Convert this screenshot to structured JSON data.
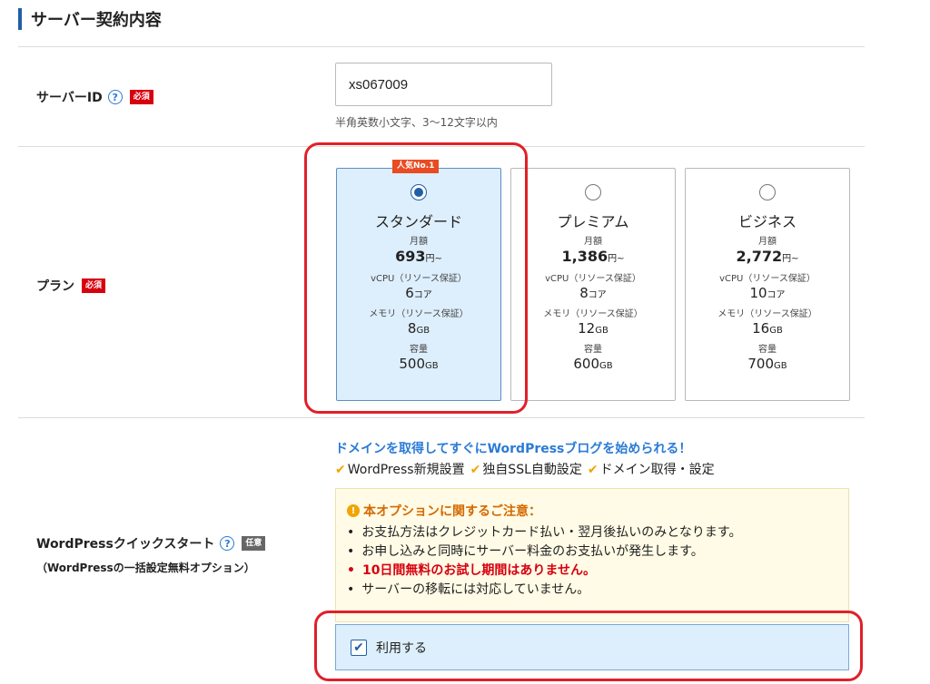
{
  "section": {
    "title": "サーバー契約内容"
  },
  "server_id": {
    "label": "サーバーID",
    "help": "?",
    "required": "必須",
    "value": "xs067009",
    "hint": "半角英数小文字、3〜12文字以内"
  },
  "plan": {
    "label": "プラン",
    "required": "必須",
    "popular_badge": "人気No.1",
    "items": [
      {
        "name": "スタンダード",
        "monthly_label": "月額",
        "price": "693",
        "price_unit": "円~",
        "vcpu_label": "vCPU（リソース保証）",
        "vcpu": "6",
        "vcpu_unit": "コア",
        "mem_label": "メモリ（リソース保証）",
        "mem": "8",
        "mem_unit": "GB",
        "storage_label": "容量",
        "storage": "500",
        "storage_unit": "GB",
        "selected": true
      },
      {
        "name": "プレミアム",
        "monthly_label": "月額",
        "price": "1,386",
        "price_unit": "円~",
        "vcpu_label": "vCPU（リソース保証）",
        "vcpu": "8",
        "vcpu_unit": "コア",
        "mem_label": "メモリ（リソース保証）",
        "mem": "12",
        "mem_unit": "GB",
        "storage_label": "容量",
        "storage": "600",
        "storage_unit": "GB",
        "selected": false
      },
      {
        "name": "ビジネス",
        "monthly_label": "月額",
        "price": "2,772",
        "price_unit": "円~",
        "vcpu_label": "vCPU（リソース保証）",
        "vcpu": "10",
        "vcpu_unit": "コア",
        "mem_label": "メモリ（リソース保証）",
        "mem": "16",
        "mem_unit": "GB",
        "storage_label": "容量",
        "storage": "700",
        "storage_unit": "GB",
        "selected": false
      }
    ]
  },
  "wordpress": {
    "label": "WordPressクイックスタート",
    "help": "?",
    "optional": "任意",
    "sublabel": "（WordPressの一括設定無料オプション）",
    "headline": "ドメインを取得してすぐにWordPressブログを始められる！",
    "check_mark": "✔",
    "features": [
      "WordPress新規設置",
      "独自SSL自動設定",
      "ドメイン取得・設定"
    ],
    "notice_icon": "!",
    "notice_title": "本オプションに関するご注意：",
    "notices": [
      "お支払方法はクレジットカード払い・翌月後払いのみとなります。",
      "お申し込みと同時にサーバー料金のお支払いが発生します。",
      "10日間無料のお試し期間はありません。",
      "サーバーの移転には対応していません。"
    ],
    "use_checkbox_mark": "✔",
    "use_label": "利用する"
  },
  "colors": {
    "accent": "#1f5fa8",
    "required": "#d7000f",
    "highlight_ring": "#e0202a",
    "selected_bg": "#ddeefc"
  }
}
